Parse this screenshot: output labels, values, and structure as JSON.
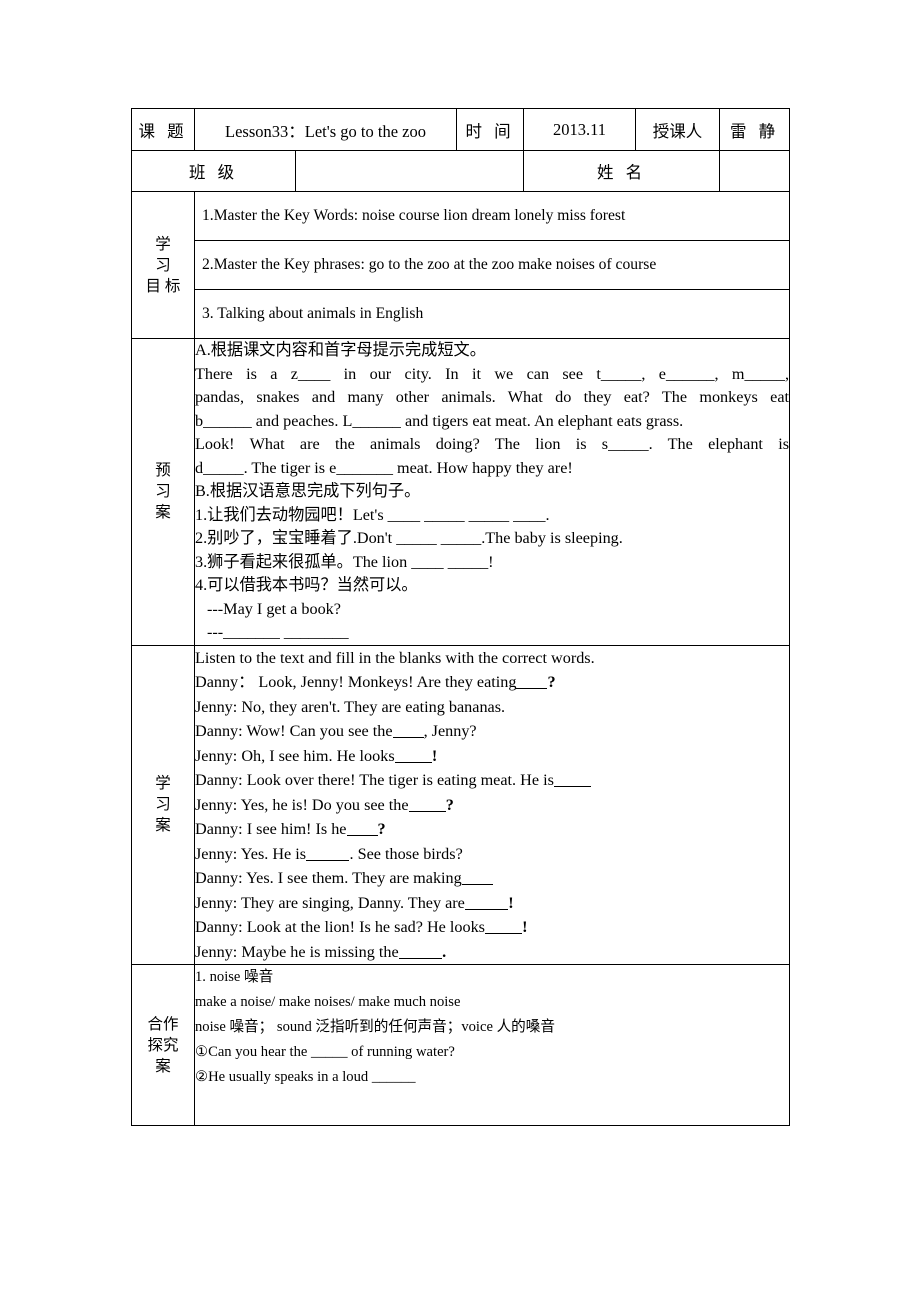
{
  "header": {
    "subject_label": "课  题",
    "lesson_title": "Lesson33：Let's go to the zoo",
    "time_label": "时  间",
    "time_value": "2013.11",
    "teacher_label": "授课人",
    "teacher_name": "雷  静",
    "class_label": "班   级",
    "class_value": "",
    "name_label": "姓   名",
    "name_value": ""
  },
  "objectives": {
    "label_lines": [
      "学",
      "习",
      "目   标"
    ],
    "items": [
      "1.Master the Key Words: noise    course    lion    dream    lonely    miss    forest",
      "2.Master the Key phrases: go to the zoo    at the zoo    make noises    of course",
      "3. Talking about animals in English"
    ]
  },
  "preview": {
    "label_lines": [
      "预",
      "习",
      "案"
    ],
    "heading_a": "A.根据课文内容和首字母提示完成短文。",
    "passage": [
      "  There  is  a  z____  in  our  city.  In  it  we  can  see  t_____,  e______,  m_____,",
      "pandas, snakes and many other animals. What do they eat? The monkeys eat",
      "b______ and peaches. L______ and tigers eat meat. An elephant eats grass.",
      "  Look!  What  are  the  animals  doing?  The  lion  is  s_____.  The  elephant  is",
      "d_____. The tiger is e_______ meat. How happy they are!"
    ],
    "heading_b": "B.根据汉语意思完成下列句子。",
    "sentences": [
      "1.让我们去动物园吧！Let's ____   _____   _____   ____.",
      "2.别吵了，宝宝睡着了.Don't _____ _____.The baby is sleeping.",
      "3.狮子看起来很孤单。The lion ____ _____!",
      "4.可以借我本书吗？当然可以。",
      "---May I get a book?",
      "---_______   ________"
    ]
  },
  "study": {
    "label_lines": [
      "学",
      "习",
      "案"
    ],
    "instruction": "Listen to the text and fill in the blanks with the correct words.",
    "dialogue": [
      {
        "speaker": "Danny：",
        "text": "  Look, Jenny! Monkeys! Are they eating",
        "blank": "_____",
        "tail": "?"
      },
      {
        "speaker": "Jenny:",
        "text": " No, they aren't. They are eating bananas.",
        "blank": "",
        "tail": ""
      },
      {
        "speaker": "Danny:",
        "text": " Wow! Can you see the",
        "blank": "_____",
        "tail": ", Jenny?"
      },
      {
        "speaker": "Jenny:",
        "text": " Oh, I see him. He looks",
        "blank": "______",
        "tail": "!"
      },
      {
        "speaker": "Danny:",
        "text": " Look over there! The tiger is eating meat. He is",
        "blank": "______",
        "tail": ""
      },
      {
        "speaker": "Jenny:",
        "text": " Yes, he is! Do you see the",
        "blank": "______",
        "tail": "?"
      },
      {
        "speaker": "Danny:",
        "text": " I see him! Is he",
        "blank": "_____",
        "tail": "?"
      },
      {
        "speaker": "Jenny:",
        "text": " Yes. He is",
        "blank": "_______",
        "tail": ". See those birds?"
      },
      {
        "speaker": "Danny:",
        "text": " Yes. I see them. They are making",
        "blank": "_____",
        "tail": ""
      },
      {
        "speaker": "Jenny:",
        "text": " They are singing, Danny. They are",
        "blank": "_______",
        "tail": "!"
      },
      {
        "speaker": "Danny:",
        "text": " Look at the lion! Is he sad? He looks",
        "blank": "______",
        "tail": "!"
      },
      {
        "speaker": "Jenny:",
        "text": " Maybe he is missing the",
        "blank": "_______",
        "tail": "."
      }
    ]
  },
  "cooperation": {
    "label_lines": [
      "合作",
      "探究",
      "案"
    ],
    "lines": [
      "1. noise  噪音",
      "make a noise/ make noises/ make much noise",
      "noise 噪音；  sound 泛指听到的任何声音；voice 人的嗓音",
      "①Can you hear the _____ of running water?",
      "②He usually speaks in a loud ______"
    ]
  }
}
